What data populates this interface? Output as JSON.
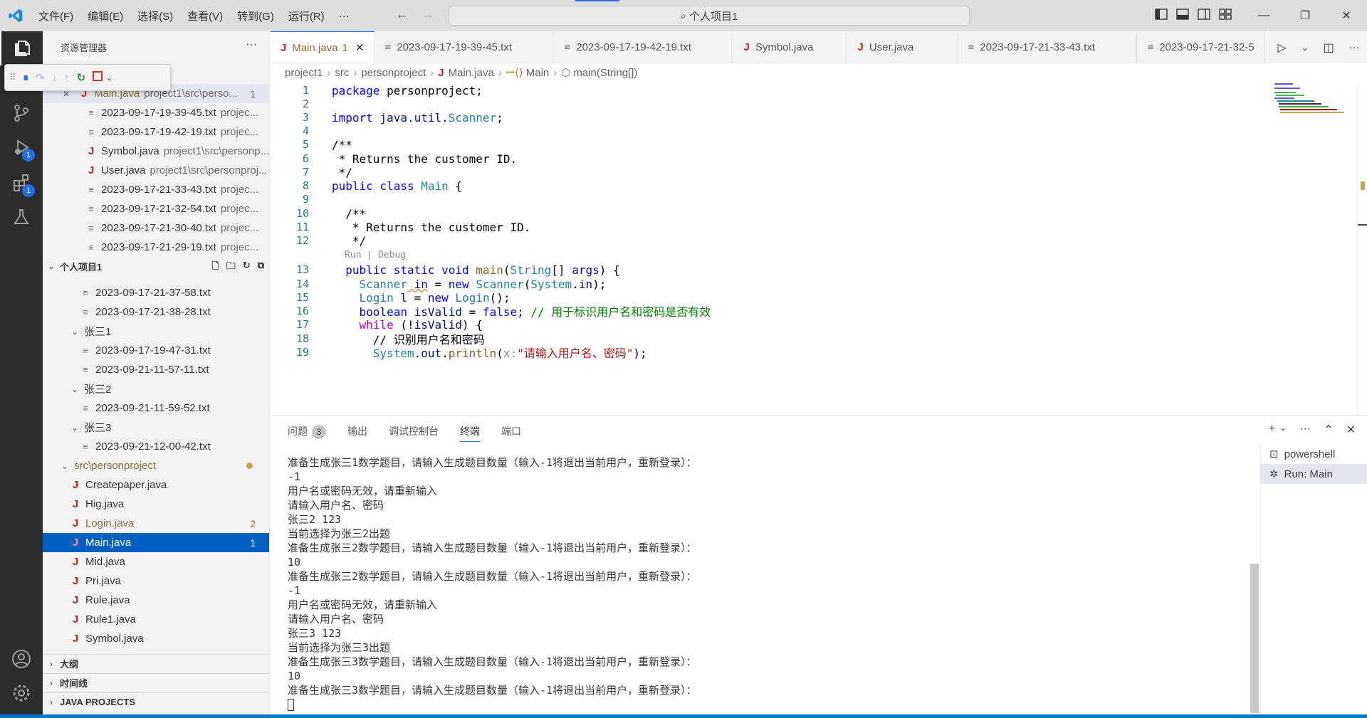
{
  "titlebar": {
    "menu": [
      "文件(F)",
      "编辑(E)",
      "选择(S)",
      "查看(V)",
      "转到(G)",
      "运行(R)",
      "···"
    ],
    "search": "个人项目1"
  },
  "activitybar": {
    "items": [
      {
        "icon": "explorer-icon"
      },
      {
        "icon": "search-icon"
      },
      {
        "icon": "source-control-icon"
      },
      {
        "icon": "run-debug-icon",
        "badge": "1"
      },
      {
        "icon": "extensions-icon",
        "badge": "1"
      },
      {
        "icon": "testing-icon"
      }
    ],
    "bottom": [
      {
        "icon": "account-icon"
      },
      {
        "icon": "settings-gear-icon"
      }
    ]
  },
  "sidebar": {
    "title": "资源管理器",
    "open_editors": [
      {
        "name": "Main.java",
        "desc": "project1\\src\\perso...",
        "count": "1",
        "type": "java"
      },
      {
        "name": "2023-09-17-19-39-45.txt",
        "desc": "projec...",
        "type": "txt"
      },
      {
        "name": "2023-09-17-19-42-19.txt",
        "desc": "projec...",
        "type": "txt"
      },
      {
        "name": "Symbol.java",
        "desc": "project1\\src\\personp...",
        "type": "java"
      },
      {
        "name": "User.java",
        "desc": "project1\\src\\personproj...",
        "type": "java"
      },
      {
        "name": "2023-09-17-21-33-43.txt",
        "desc": "projec...",
        "type": "txt"
      },
      {
        "name": "2023-09-17-21-32-54.txt",
        "desc": "projec...",
        "type": "txt"
      },
      {
        "name": "2023-09-17-21-30-40.txt",
        "desc": "projec...",
        "type": "txt"
      },
      {
        "name": "2023-09-17-21-29-19.txt",
        "desc": "projec...",
        "type": "txt"
      }
    ],
    "project_title": "个人项目1",
    "tree": [
      {
        "name": "2023-09-17-21-37-58.txt",
        "indent": 1,
        "type": "txt"
      },
      {
        "name": "2023-09-17-21-38-28.txt",
        "indent": 1,
        "type": "txt"
      },
      {
        "name": "张三1",
        "indent": 0,
        "type": "folder"
      },
      {
        "name": "2023-09-17-19-47-31.txt",
        "indent": 1,
        "type": "txt"
      },
      {
        "name": "2023-09-21-11-57-11.txt",
        "indent": 1,
        "type": "txt"
      },
      {
        "name": "张三2",
        "indent": 0,
        "type": "folder"
      },
      {
        "name": "2023-09-21-11-59-52.txt",
        "indent": 1,
        "type": "txt"
      },
      {
        "name": "张三3",
        "indent": 0,
        "type": "folder"
      },
      {
        "name": "2023-09-21-12-00-42.txt",
        "indent": 1,
        "type": "txt"
      },
      {
        "name": "src\\personproject",
        "indent": -1,
        "type": "folder",
        "dot": true
      },
      {
        "name": "Createpaper.java",
        "indent": 0,
        "type": "java"
      },
      {
        "name": "Hig.java",
        "indent": 0,
        "type": "java"
      },
      {
        "name": "Login.java",
        "indent": 0,
        "type": "java",
        "count": "2"
      },
      {
        "name": "Main.java",
        "indent": 0,
        "type": "java",
        "count": "1",
        "selected": true
      },
      {
        "name": "Mid.java",
        "indent": 0,
        "type": "java"
      },
      {
        "name": "Pri.java",
        "indent": 0,
        "type": "java"
      },
      {
        "name": "Rule.java",
        "indent": 0,
        "type": "java"
      },
      {
        "name": "Rule1.java",
        "indent": 0,
        "type": "java"
      },
      {
        "name": "Symbol.java",
        "indent": 0,
        "type": "java"
      }
    ],
    "sections": [
      "大纲",
      "时间线",
      "JAVA PROJECTS"
    ]
  },
  "tabs": [
    {
      "label": "Main.java",
      "suffix": "1",
      "type": "java",
      "active": true
    },
    {
      "label": "2023-09-17-19-39-45.txt",
      "type": "txt"
    },
    {
      "label": "2023-09-17-19-42-19.txt",
      "type": "txt"
    },
    {
      "label": "Symbol.java",
      "type": "java"
    },
    {
      "label": "User.java",
      "type": "java"
    },
    {
      "label": "2023-09-17-21-33-43.txt",
      "type": "txt"
    },
    {
      "label": "2023-09-17-21-32-5",
      "type": "txt"
    }
  ],
  "breadcrumb": {
    "parts": [
      "project1",
      "src",
      "personproject",
      "Main.java",
      "Main",
      "main(String[])"
    ]
  },
  "editor": {
    "codelens": "Run | Debug",
    "lines": [
      {
        "n": "1"
      },
      {
        "n": "2"
      },
      {
        "n": "3"
      },
      {
        "n": "4"
      },
      {
        "n": "5"
      },
      {
        "n": "6"
      },
      {
        "n": "7"
      },
      {
        "n": "8"
      },
      {
        "n": "9"
      },
      {
        "n": "10"
      },
      {
        "n": "11"
      },
      {
        "n": "12"
      },
      {
        "n": "13"
      },
      {
        "n": "14"
      },
      {
        "n": "15"
      },
      {
        "n": "16"
      },
      {
        "n": "17"
      },
      {
        "n": "18"
      },
      {
        "n": "19"
      }
    ],
    "code": {
      "l1a": "package",
      "l1b": " personproject;",
      "l3a": "import",
      "l3b": " java.util.",
      "l3c": "Scanner",
      "l3d": ";",
      "l5": "/**",
      "l6": " * Returns the customer ID.",
      "l7": " */",
      "l8a": "public",
      "l8b": " class",
      "l8c": " Main",
      "l8d": " {",
      "l10": "  /**",
      "l11": "   * Returns the customer ID.",
      "l12": "   */",
      "l13a": "  public",
      "l13b": " static",
      "l13c": " void",
      "l13d": " main",
      "l13e": "(",
      "l13f": "String",
      "l13g": "[] ",
      "l13h": "args",
      "l13i": ") {",
      "l14a": "    Scanner",
      "l14b": " in",
      "l14c": " = ",
      "l14d": "new",
      "l14e": " Scanner",
      "l14f": "(",
      "l14g": "System",
      "l14h": ".",
      "l14i": "in",
      "l14j": ");",
      "l15a": "    Login",
      "l15b": " l",
      "l15c": " = ",
      "l15d": "new",
      "l15e": " Login",
      "l15f": "();",
      "l16a": "    boolean",
      "l16b": " isValid",
      "l16c": " = ",
      "l16d": "false",
      "l16e": "; ",
      "l16f": "// 用于标识用户名和密码是否有效",
      "l17a": "    while",
      "l17b": " (!",
      "l17c": "isValid",
      "l17d": ") {",
      "l18": "      // 识别用户名和密码",
      "l19a": "      System",
      "l19b": ".",
      "l19c": "out",
      "l19d": ".",
      "l19e": "println",
      "l19f": "(",
      "l19g": "x:",
      "l19h": "\"请输入用户名、密码\"",
      "l19i": ");"
    }
  },
  "panel": {
    "tabs": [
      "问题",
      "输出",
      "调试控制台",
      "终端",
      "端口"
    ],
    "problems_count": "3",
    "active_tab": "终端",
    "terminal_lines": [
      "准备生成张三1数学题目，请输入生成题目数量（输入-1将退出当前用户，重新登录）：",
      "-1",
      "用户名或密码无效，请重新输入",
      "请输入用户名、密码",
      "张三2 123",
      "当前选择为张三2出题",
      "准备生成张三2数学题目，请输入生成题目数量（输入-1将退出当前用户，重新登录）：",
      "10",
      "准备生成张三2数学题目，请输入生成题目数量（输入-1将退出当前用户，重新登录）：",
      "-1",
      "用户名或密码无效，请重新输入",
      "请输入用户名、密码",
      "张三3 123",
      "当前选择为张三3出题",
      "准备生成张三3数学题目，请输入生成题目数量（输入-1将退出当前用户，重新登录）：",
      "10",
      "准备生成张三3数学题目，请输入生成题目数量（输入-1将退出当前用户，重新登录）："
    ],
    "terminals": [
      "powershell",
      "Run: Main"
    ]
  },
  "colors": {
    "accent": "#007acc",
    "selected_row": "#0060c0",
    "java_icon": "#c5221f"
  }
}
